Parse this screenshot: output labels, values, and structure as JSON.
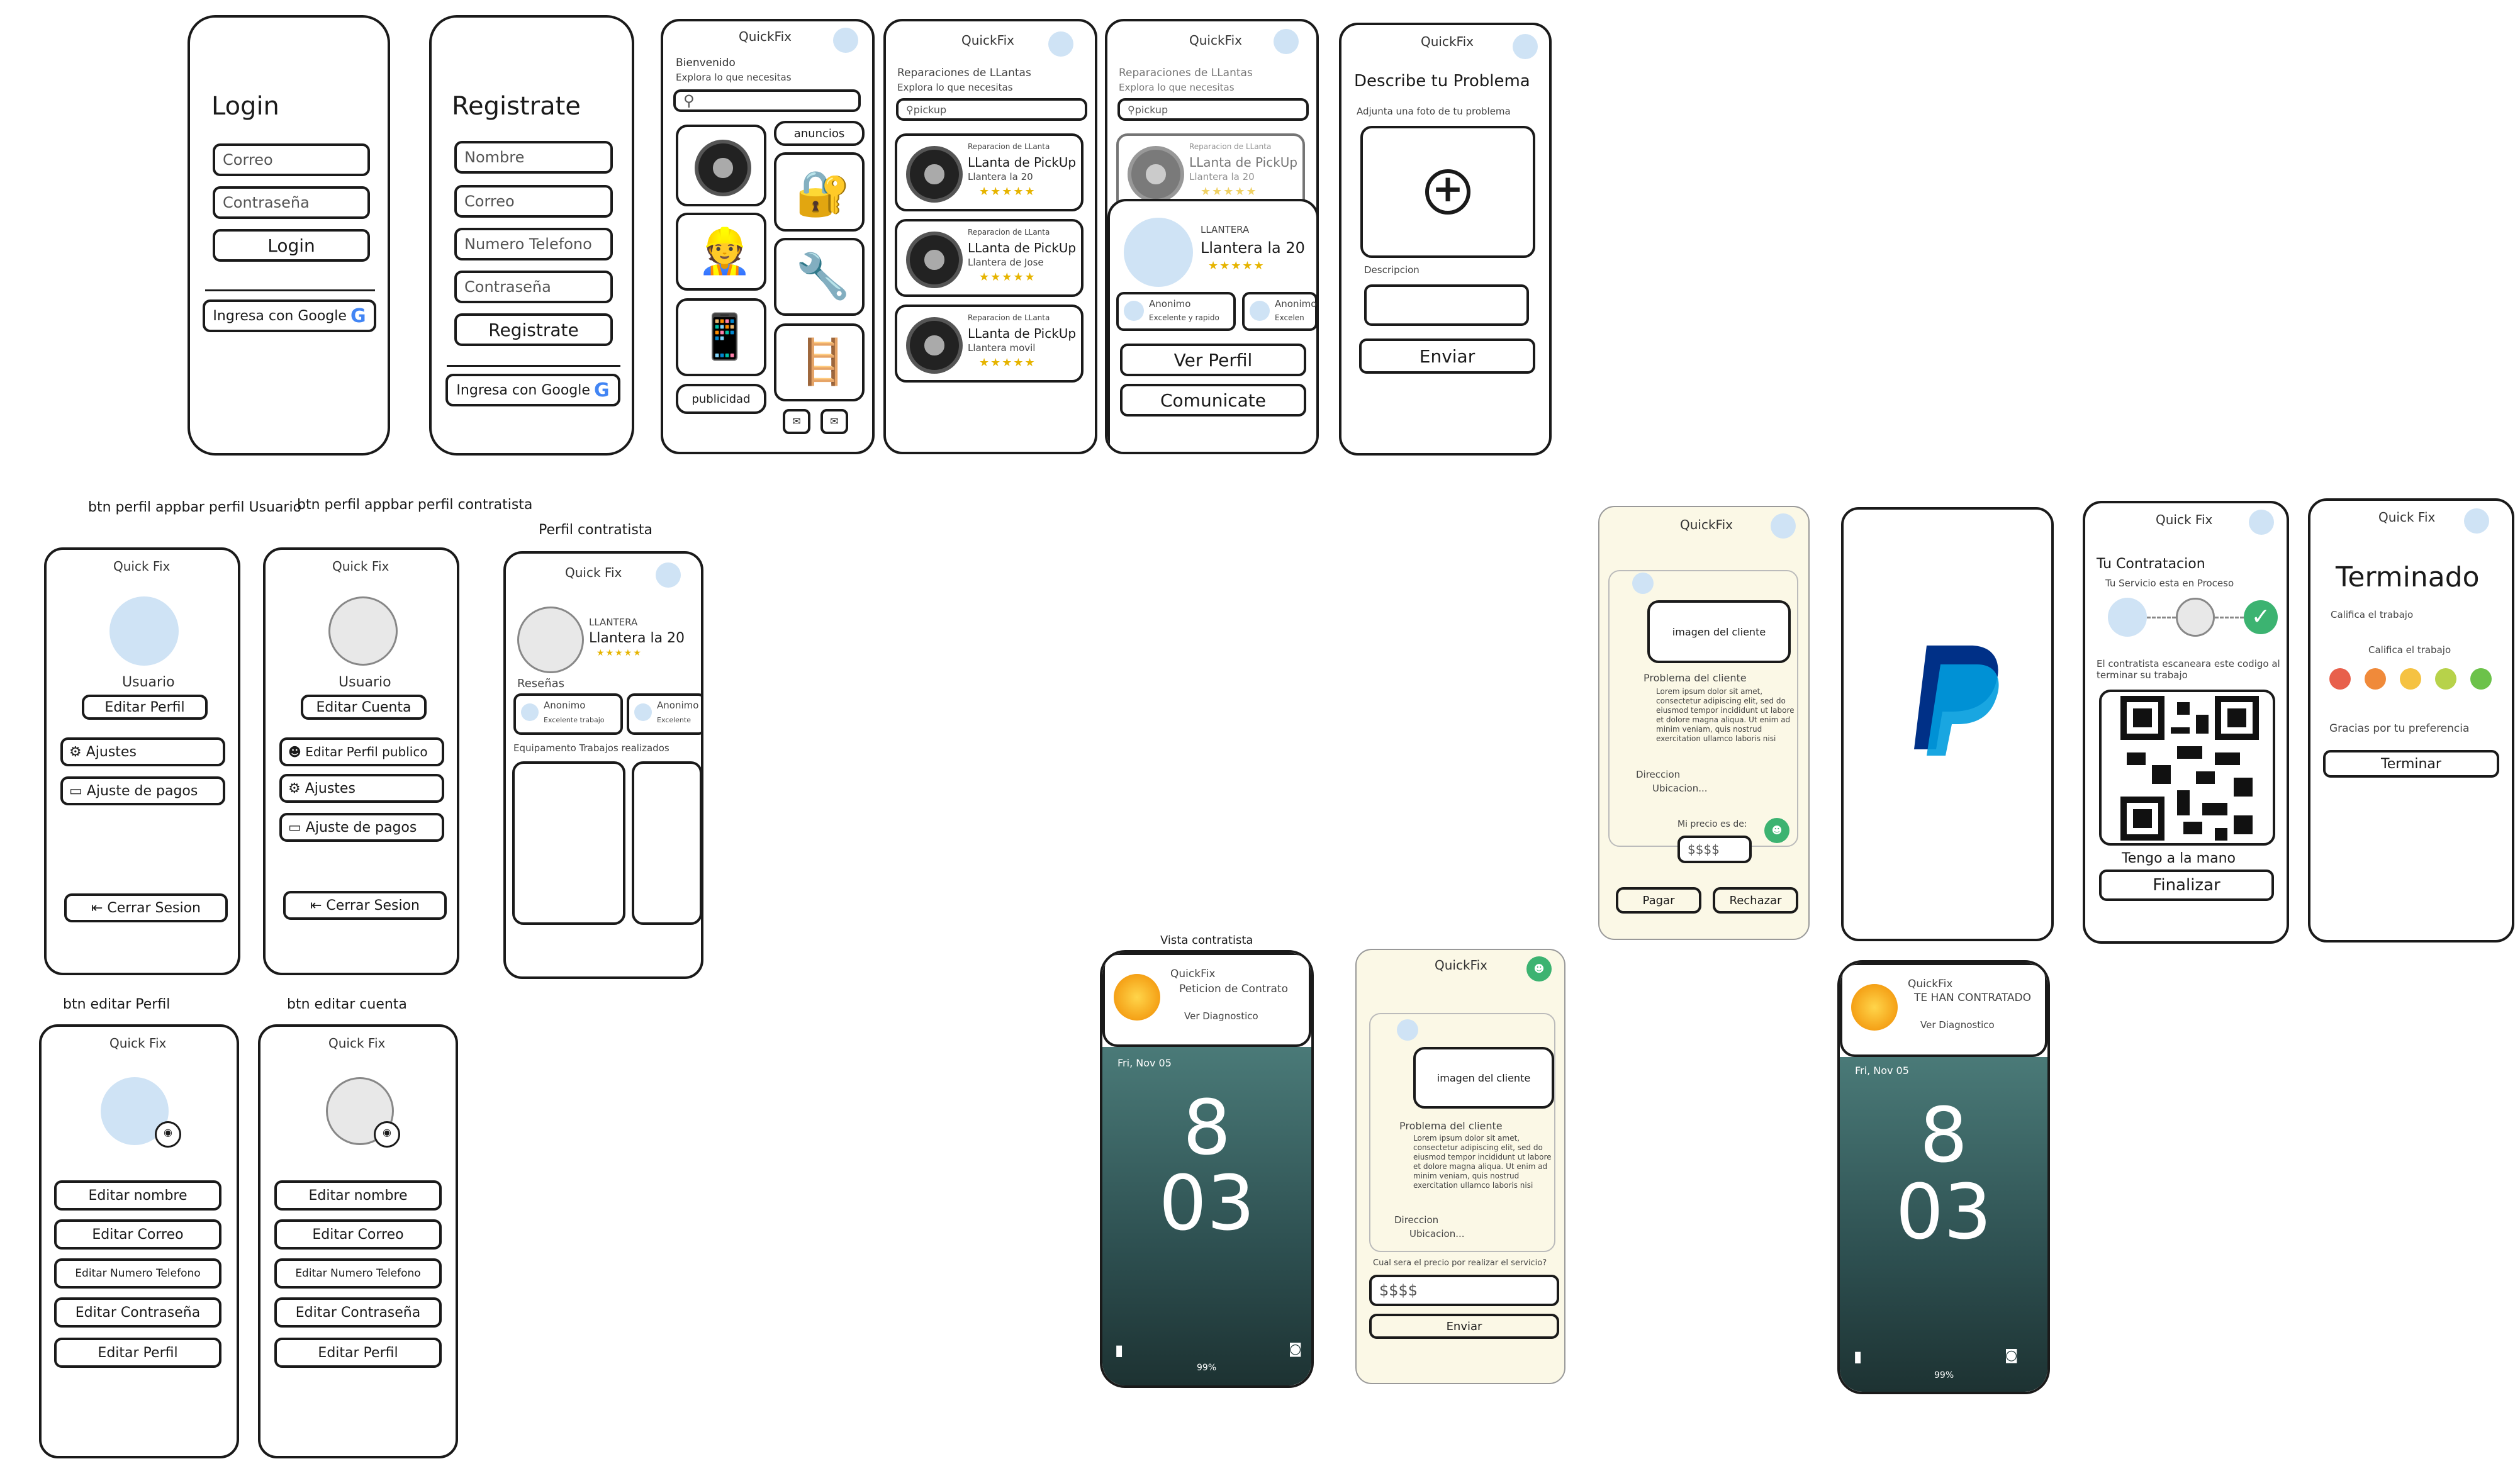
{
  "login": {
    "title": "Login",
    "email_ph": "Correo",
    "password_ph": "Contraseña",
    "login_btn": "Login",
    "google_btn": "Ingresa con Google"
  },
  "register": {
    "title": "Registrate",
    "name_ph": "Nombre",
    "email_ph": "Correo",
    "phone_ph": "Numero Telefono",
    "password_ph": "Contraseña",
    "register_btn": "Registrate",
    "google_btn": "Ingresa con Google"
  },
  "home": {
    "app": "QuickFix",
    "welcome": "Bienvenido",
    "sub": "Explora lo que necesitas",
    "ads": "anuncios",
    "publicity": "publicidad"
  },
  "list": {
    "app": "QuickFix",
    "heading": "Reparaciones de LLantas",
    "sub": "Explora lo que necesitas",
    "search": "pickup",
    "items": [
      {
        "cat": "Reparacion de LLanta",
        "name": "LLanta de PickUp",
        "shop": "Llantera la 20",
        "stars": "★★★★★"
      },
      {
        "cat": "Reparacion de LLanta",
        "name": "LLanta de PickUp",
        "shop": "Llantera de Jose",
        "stars": "★★★★★"
      },
      {
        "cat": "Reparacion de LLanta",
        "name": "LLanta de PickUp",
        "shop": "Llantera movil",
        "stars": "★★★★★"
      }
    ]
  },
  "detail": {
    "app": "QuickFix",
    "heading": "Reparaciones de LLantas",
    "sub": "Explora lo que necesitas",
    "search": "pickup",
    "item": {
      "cat": "Reparacion de LLanta",
      "name": "LLanta de PickUp",
      "shop": "Llantera la 20",
      "stars": "★★★★★"
    },
    "type": "LLANTERA",
    "shop": "Llantera la 20",
    "stars": "★★★★★",
    "review1_name": "Anonimo",
    "review1_text": "Excelente y rapido",
    "review2_name": "Anonimo",
    "review2_text": "Excelen",
    "profile_btn": "Ver Perfil",
    "contact_btn": "Comunicate"
  },
  "describe": {
    "app": "QuickFix",
    "title": "Describe tu Problema",
    "photo_label": "Adjunta una foto de tu problema",
    "desc_label": "Descripcion",
    "send_btn": "Enviar"
  },
  "labels": {
    "user_profile": "btn perfil appbar perfil Usuario",
    "contr_profile": "btn perfil appbar perfil contratista",
    "contr_public": "Perfil contratista",
    "edit_profile": "btn editar Perfil",
    "edit_account": "btn editar cuenta",
    "contr_view": "Vista contratista"
  },
  "user": {
    "app": "Quick Fix",
    "role": "Usuario",
    "edit_btn": "Editar Perfil",
    "settings": "Ajustes",
    "payments": "Ajuste de pagos",
    "logout": "Cerrar Sesion"
  },
  "contr": {
    "app": "Quick Fix",
    "role": "Usuario",
    "edit_btn": "Editar Cuenta",
    "public": "Editar Perfil publico",
    "settings": "Ajustes",
    "payments": "Ajuste de pagos",
    "logout": "Cerrar Sesion"
  },
  "pub": {
    "app": "Quick Fix",
    "type": "LLANTERA",
    "shop": "Llantera la 20",
    "stars": "★★★★★",
    "reviews": "Reseñas",
    "r1": "Anonimo",
    "r1t": "Excelente trabajo",
    "r2": "Anonimo",
    "r2t": "Excelente",
    "equipment": "Equipamento Trabajos realizados"
  },
  "edit_user": {
    "app": "Quick Fix",
    "b1": "Editar nombre",
    "b2": "Editar Correo",
    "b3": "Editar Numero Telefono",
    "b4": "Editar Contraseña",
    "b5": "Editar Perfil"
  },
  "edit_contr": {
    "app": "Quick Fix",
    "b1": "Editar nombre",
    "b2": "Editar Correo",
    "b3": "Editar Numero Telefono",
    "b4": "Editar Contraseña",
    "b5": "Editar Perfil"
  },
  "lock1": {
    "app": "QuickFix",
    "line1": "Peticion de Contrato",
    "line2": "Ver Diagnostico",
    "date": "Fri, Nov 05",
    "hour": "8",
    "minute": "03",
    "battery": "99%"
  },
  "lock2": {
    "app": "QuickFix",
    "line1": "TE HAN CONTRATADO",
    "line2": "Ver Diagnostico",
    "date": "Fri, Nov 05",
    "hour": "8",
    "minute": "03",
    "battery": "99%"
  },
  "chat_contr": {
    "app": "QuickFix",
    "image": "imagen del cliente",
    "problem": "Problema del cliente",
    "lorem": "Lorem ipsum dolor sit amet, consectetur adipiscing elit, sed do eiusmod tempor incididunt ut labore et dolore magna aliqua. Ut enim ad minim veniam, quis nostrud exercitation ullamco laboris nisi",
    "address": "Direccion",
    "location": "Ubicacion...",
    "question": "Cual sera el precio por realizar el servicio?",
    "price": "$$$$",
    "send": "Enviar"
  },
  "chat_user": {
    "app": "QuickFix",
    "image": "imagen del cliente",
    "problem": "Problema del cliente",
    "lorem": "Lorem ipsum dolor sit amet, consectetur adipiscing elit, sed do eiusmod tempor incididunt ut labore et dolore magna aliqua. Ut enim ad minim veniam, quis nostrud exercitation ullamco laboris nisi",
    "address": "Direccion",
    "location": "Ubicacion...",
    "price_label": "Mi precio es de:",
    "price": "$$$$",
    "pay": "Pagar",
    "reject": "Rechazar"
  },
  "hire": {
    "app": "Quick Fix",
    "title": "Tu Contratacion",
    "status": "Tu Servicio esta en Proceso",
    "qr_note": "El contratista escaneara este codigo al terminar su trabajo",
    "hand": "Tengo a la mano",
    "finish": "Finalizar"
  },
  "done": {
    "app": "Quick Fix",
    "title": "Terminado",
    "rate": "Califica el trabajo",
    "rate2": "Califica el trabajo",
    "thanks": "Gracias por tu preferencia",
    "finish": "Terminar"
  },
  "colors": {
    "paypal_dark": "#003087",
    "paypal_light": "#009cde",
    "check": "#3cb371",
    "star": "#e6b400"
  }
}
